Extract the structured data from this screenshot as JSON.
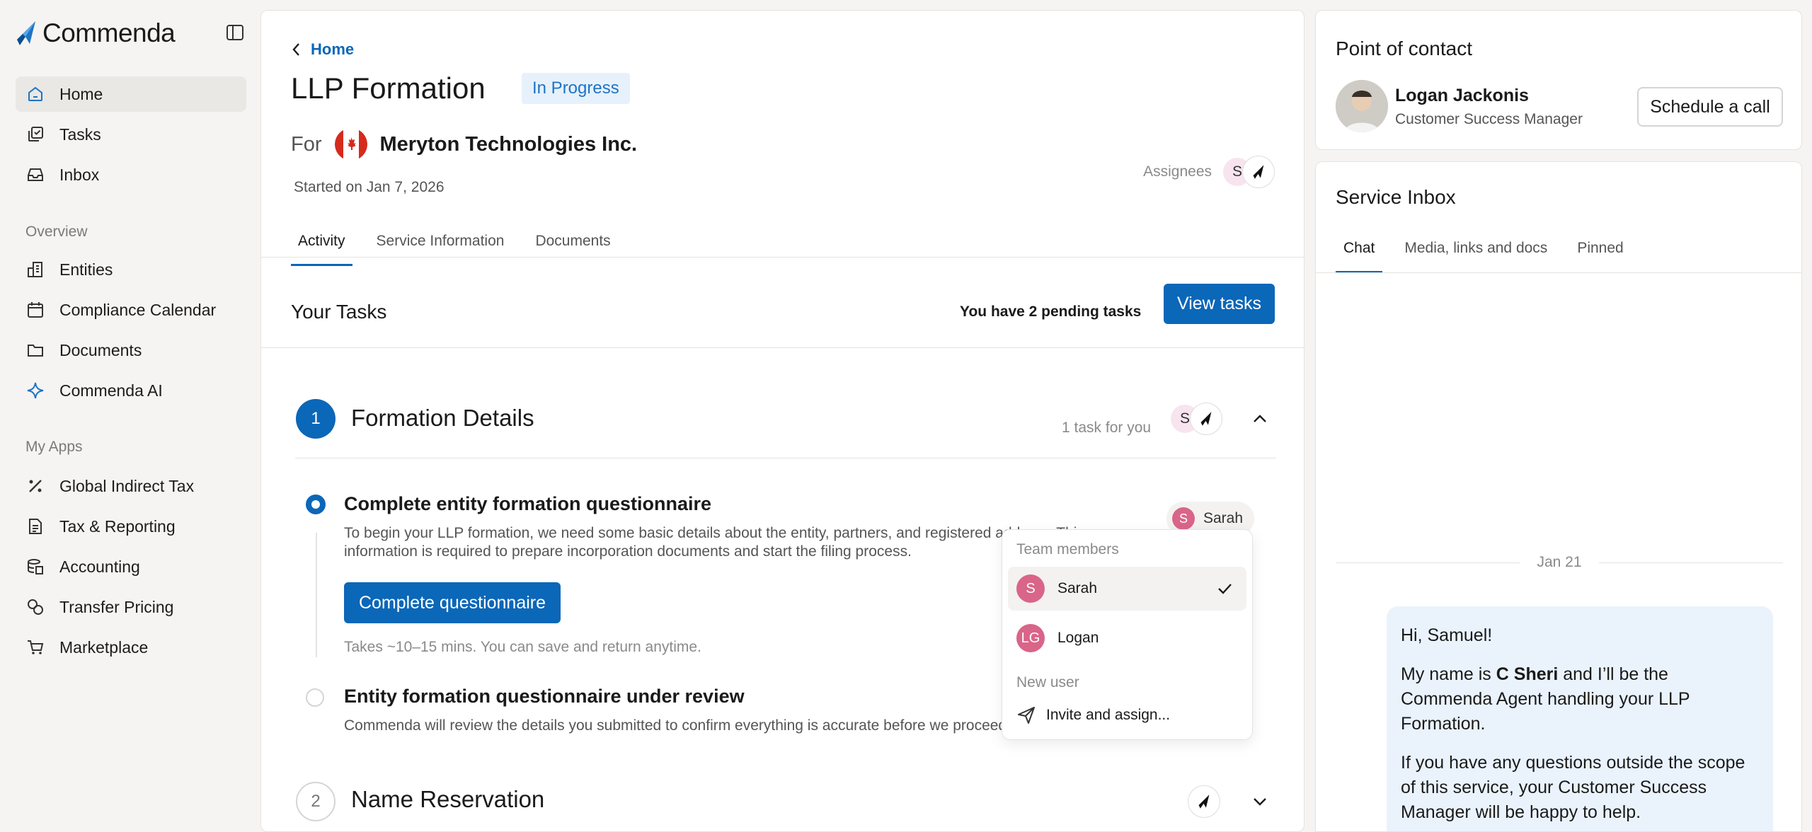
{
  "app": {
    "name": "Commenda"
  },
  "sidebar": {
    "items": [
      {
        "label": "Home",
        "icon": "home-icon",
        "active": true
      },
      {
        "label": "Tasks",
        "icon": "tasks-icon"
      },
      {
        "label": "Inbox",
        "icon": "inbox-icon"
      }
    ],
    "overview_label": "Overview",
    "overview": [
      {
        "label": "Entities",
        "icon": "building-icon"
      },
      {
        "label": "Compliance Calendar",
        "icon": "calendar-icon"
      },
      {
        "label": "Documents",
        "icon": "folder-icon"
      },
      {
        "label": "Commenda AI",
        "icon": "sparkle-icon"
      }
    ],
    "apps_label": "My Apps",
    "apps": [
      {
        "label": "Global Indirect Tax",
        "icon": "percent-icon"
      },
      {
        "label": "Tax & Reporting",
        "icon": "document-icon"
      },
      {
        "label": "Accounting",
        "icon": "database-icon"
      },
      {
        "label": "Transfer Pricing",
        "icon": "transfer-icon"
      },
      {
        "label": "Marketplace",
        "icon": "cart-icon"
      }
    ]
  },
  "header": {
    "back_label": "Home",
    "title": "LLP Formation",
    "status": "In Progress",
    "for_label": "For",
    "company": "Meryton Technologies Inc.",
    "started": "Started on Jan 7, 2026",
    "assignees_label": "Assignees",
    "assignee_initial": "S"
  },
  "tabs": [
    "Activity",
    "Service Information",
    "Documents"
  ],
  "tasks_bar": {
    "title": "Your Tasks",
    "pending": "You have 2 pending tasks",
    "button": "View tasks"
  },
  "steps": [
    {
      "number": "1",
      "title": "Formation Details",
      "count": "1 task for you",
      "assignee_initial": "S"
    },
    {
      "number": "2",
      "title": "Name Reservation"
    }
  ],
  "step1_tasks": [
    {
      "title": "Complete entity formation questionnaire",
      "description_line1": "To begin your LLP formation, we need some basic details about the entity, partners, and registered address. This",
      "description_line2": "information is required to prepare incorporation documents and start the filing process.",
      "button": "Complete questionnaire",
      "note": "Takes ~10–15 mins. You can save and return anytime.",
      "assignee": {
        "initial": "S",
        "name": "Sarah"
      }
    },
    {
      "title": "Entity formation questionnaire under review",
      "description_line1": "Commenda will review the details you submitted to confirm everything is accurate before we proceed."
    }
  ],
  "dropdown": {
    "team_label": "Team members",
    "members": [
      {
        "initials": "S",
        "name": "Sarah",
        "selected": true
      },
      {
        "initials": "LG",
        "name": "Logan"
      }
    ],
    "new_user_label": "New user",
    "invite_label": "Invite and assign..."
  },
  "contact": {
    "title": "Point of contact",
    "name": "Logan Jackonis",
    "role": "Customer Success Manager",
    "button": "Schedule a call"
  },
  "inbox": {
    "title": "Service Inbox",
    "tabs": [
      "Chat",
      "Media, links and docs",
      "Pinned"
    ],
    "date": "Jan 21",
    "message": {
      "greeting": "Hi, Samuel!",
      "p1_before": "My name is ",
      "p1_bold": "C Sheri",
      "p1_after": " and I’ll be the Commenda Agent handling your LLP Formation.",
      "p2": "If you have any questions outside the scope of this service, your Customer Success Manager will be happy to help."
    }
  },
  "colors": {
    "accent": "#0b67b8",
    "badge_bg": "#e6f1fb",
    "avatar_pink": "#d96589"
  }
}
